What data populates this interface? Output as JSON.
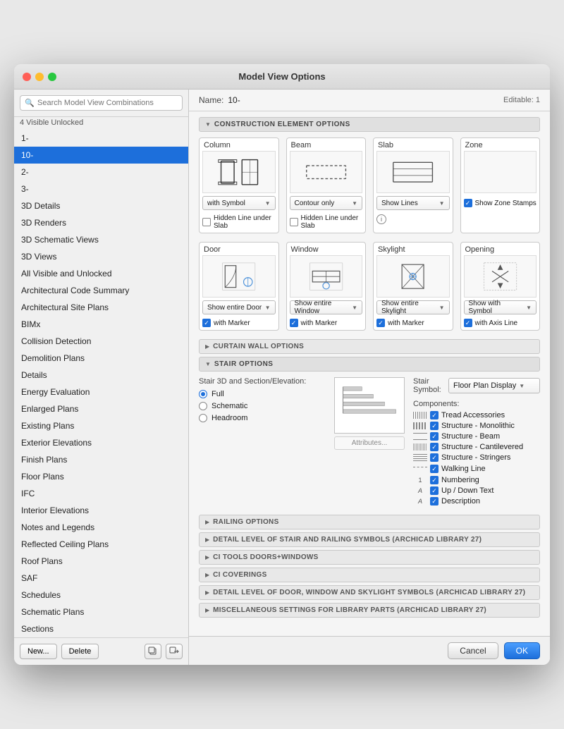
{
  "window": {
    "title": "Model View Options"
  },
  "sidebar": {
    "search_placeholder": "Search Model View Combinations",
    "visible_unlocked": "4 Visible Unlocked",
    "items": [
      {
        "label": "1-",
        "active": false
      },
      {
        "label": "10-",
        "active": true
      },
      {
        "label": "2-",
        "active": false
      },
      {
        "label": "3-",
        "active": false
      },
      {
        "label": "3D Details",
        "active": false
      },
      {
        "label": "3D Renders",
        "active": false
      },
      {
        "label": "3D Schematic Views",
        "active": false
      },
      {
        "label": "3D Views",
        "active": false
      },
      {
        "label": "All Visible and Unlocked",
        "active": false
      },
      {
        "label": "Architectural Code Summary",
        "active": false
      },
      {
        "label": "Architectural Site Plans",
        "active": false
      },
      {
        "label": "BIMx",
        "active": false
      },
      {
        "label": "Collision Detection",
        "active": false
      },
      {
        "label": "Demolition Plans",
        "active": false
      },
      {
        "label": "Details",
        "active": false
      },
      {
        "label": "Energy Evaluation",
        "active": false
      },
      {
        "label": "Enlarged Plans",
        "active": false
      },
      {
        "label": "Existing Plans",
        "active": false
      },
      {
        "label": "Exterior Elevations",
        "active": false
      },
      {
        "label": "Finish Plans",
        "active": false
      },
      {
        "label": "Floor Plans",
        "active": false
      },
      {
        "label": "IFC",
        "active": false
      },
      {
        "label": "Interior Elevations",
        "active": false
      },
      {
        "label": "Notes and Legends",
        "active": false
      },
      {
        "label": "Reflected Ceiling Plans",
        "active": false
      },
      {
        "label": "Roof Plans",
        "active": false
      },
      {
        "label": "SAF",
        "active": false
      },
      {
        "label": "Schedules",
        "active": false
      },
      {
        "label": "Schematic Plans",
        "active": false
      },
      {
        "label": "Sections",
        "active": false
      }
    ],
    "buttons": {
      "new": "New...",
      "delete": "Delete"
    }
  },
  "main": {
    "name_label": "Name:",
    "name_value": "10-",
    "editable": "Editable: 1",
    "sections": {
      "construction": "CONSTRUCTION ELEMENT OPTIONS",
      "curtain_wall": "CURTAIN WALL OPTIONS",
      "stair": "STAIR OPTIONS",
      "railing": "RAILING OPTIONS",
      "detail_level": "DETAIL LEVEL OF STAIR AND RAILING SYMBOLS (ARCHICAD LIBRARY 27)",
      "ci_doors_windows": "CI TOOLS DOORS+WINDOWS",
      "ci_coverings": "CI COVERINGS",
      "detail_level_door": "DETAIL LEVEL OF DOOR, WINDOW AND SKYLIGHT SYMBOLS (ARCHICAD LIBRARY 27)",
      "misc_settings": "MISCELLANEOUS SETTINGS FOR LIBRARY PARTS (ARCHICAD LIBRARY 27)"
    },
    "construction": {
      "column": {
        "label": "Column",
        "dropdown": "with Symbol",
        "checkbox1": {
          "label": "Hidden Line under Slab",
          "checked": false
        }
      },
      "beam": {
        "label": "Beam",
        "dropdown": "Contour only",
        "checkbox1": {
          "label": "Hidden Line under Slab",
          "checked": false
        }
      },
      "slab": {
        "label": "Slab",
        "dropdown": "Show Lines",
        "has_info": true
      },
      "zone": {
        "label": "Zone",
        "show_zone_stamps": {
          "label": "Show Zone Stamps",
          "checked": true
        }
      },
      "door": {
        "label": "Door",
        "dropdown": "Show entire Door",
        "with_marker": {
          "label": "with Marker",
          "checked": true
        }
      },
      "window": {
        "label": "Window",
        "dropdown": "Show entire Window",
        "with_marker": {
          "label": "with Marker",
          "checked": true
        }
      },
      "skylight": {
        "label": "Skylight",
        "dropdown": "Show entire Skylight",
        "with_marker": {
          "label": "with Marker",
          "checked": true
        }
      },
      "opening": {
        "label": "Opening",
        "dropdown": "Show with Symbol",
        "with_axis": {
          "label": "with Axis Line",
          "checked": true
        }
      }
    },
    "stair": {
      "stair_3d_label": "Stair 3D and Section/Elevation:",
      "radios": [
        {
          "label": "Full",
          "selected": true
        },
        {
          "label": "Schematic",
          "selected": false
        },
        {
          "label": "Headroom",
          "selected": false
        }
      ],
      "stair_symbol_label": "Stair Symbol:",
      "floor_plan_display": "Floor Plan Display",
      "attrs_button": "Attributes...",
      "components_label": "Components:",
      "components": [
        {
          "label": "Tread Accessories",
          "checked": true
        },
        {
          "label": "Structure - Monolithic",
          "checked": true
        },
        {
          "label": "Structure - Beam",
          "checked": true
        },
        {
          "label": "Structure - Cantilevered",
          "checked": true
        },
        {
          "label": "Structure - Stringers",
          "checked": true
        },
        {
          "label": "Walking Line",
          "checked": true
        },
        {
          "label": "Numbering",
          "checked": true
        },
        {
          "label": "Up / Down Text",
          "checked": true
        },
        {
          "label": "Description",
          "checked": true
        }
      ]
    },
    "footer": {
      "cancel": "Cancel",
      "ok": "OK"
    }
  }
}
